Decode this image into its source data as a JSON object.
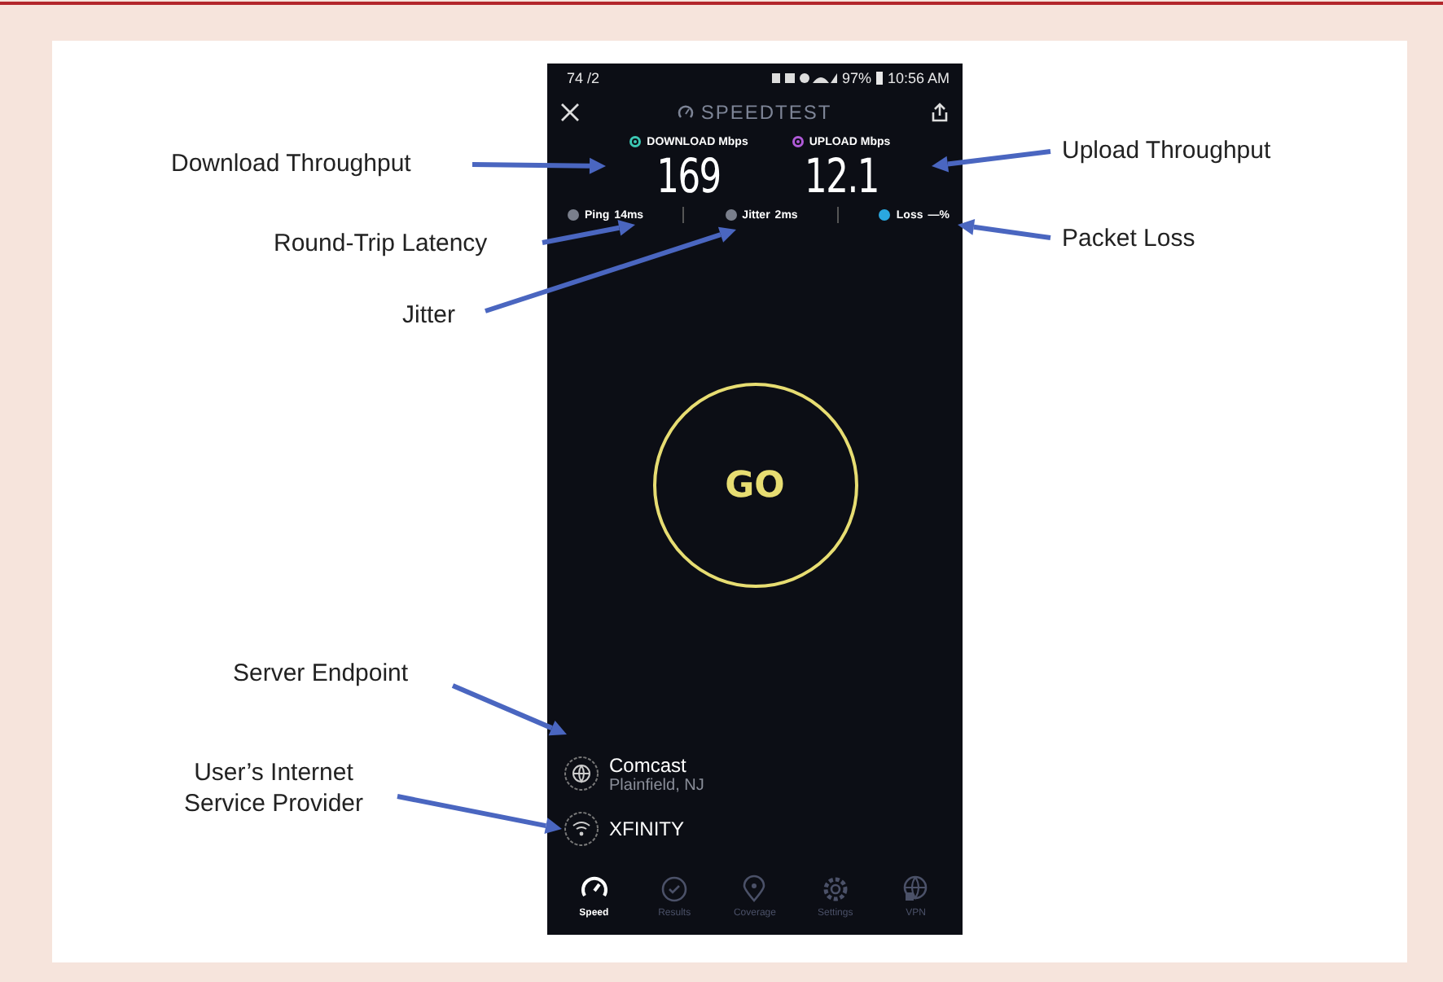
{
  "annotations": [
    {
      "text": "Download Throughput"
    },
    {
      "text": "Upload Throughput"
    },
    {
      "text": "Round-Trip Latency"
    },
    {
      "text": "Packet Loss"
    },
    {
      "text": "Jitter"
    },
    {
      "text": "Server Endpoint"
    },
    {
      "text": "User’s Internet Service Provider"
    }
  ],
  "phone": {
    "status_bar": {
      "left": "74 /2",
      "battery": "97%",
      "time": "10:56 AM"
    },
    "title": "SPEEDTEST",
    "metrics": [
      {
        "label": "DOWNLOAD Mbps",
        "value": "169",
        "color": "#3cc8b4"
      },
      {
        "label": "UPLOAD Mbps",
        "value": "12.1",
        "color": "#b05ad8"
      }
    ],
    "stats": [
      {
        "label": "Ping",
        "value": "14ms",
        "color": "#7a7f8c"
      },
      {
        "label": "Jitter",
        "value": "2ms",
        "color": "#7a7f8c"
      },
      {
        "label": "Loss",
        "value": "—%",
        "color": "#2aa8e0"
      }
    ],
    "go_button": "GO",
    "server": {
      "name": "Comcast",
      "location": "Plainfield, NJ"
    },
    "provider": {
      "name": "XFINITY"
    },
    "tabs": [
      {
        "label": "Speed",
        "selected": true
      },
      {
        "label": "Results",
        "selected": false
      },
      {
        "label": "Coverage",
        "selected": false
      },
      {
        "label": "Settings",
        "selected": false
      },
      {
        "label": "VPN",
        "selected": false
      }
    ]
  }
}
